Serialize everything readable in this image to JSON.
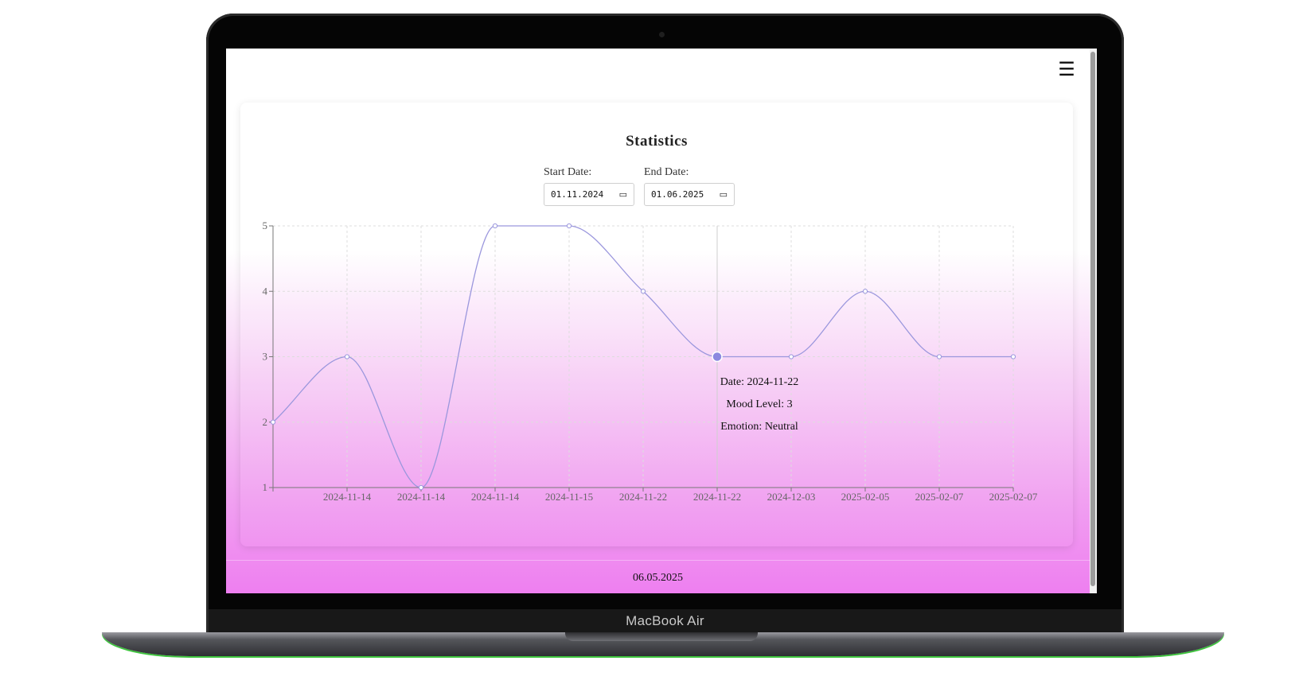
{
  "device": {
    "brand": "MacBook Air"
  },
  "header": {
    "menu_icon": "☰"
  },
  "page": {
    "title": "Statistics"
  },
  "filters": {
    "start_label": "Start Date:",
    "start_value": "01.11.2024",
    "end_label": "End Date:",
    "end_value": "01.06.2025",
    "calendar_icon": "calendar-icon"
  },
  "tooltip": {
    "date": "Date: 2024-11-22",
    "mood": "Mood Level: 3",
    "emotion": "Emotion: Neutral"
  },
  "footer": {
    "date": "06.05.2025"
  },
  "colors": {
    "line": "#9b97dd",
    "active_point": "#8c89e0",
    "gradient_end": "#ee7ff0"
  },
  "chart_data": {
    "type": "line",
    "x": [
      "",
      "2024-11-14",
      "2024-11-14",
      "2024-11-14",
      "2024-11-15",
      "2024-11-22",
      "2024-11-22",
      "2024-12-03",
      "2025-02-05",
      "2025-02-07",
      "2025-02-07"
    ],
    "series": [
      {
        "values": [
          2,
          3,
          1,
          5,
          5,
          4,
          3,
          3,
          4,
          3,
          3
        ]
      }
    ],
    "active_index": 6,
    "ylim": [
      1,
      5
    ],
    "yticks": [
      1,
      2,
      3,
      4,
      5
    ],
    "grid": true,
    "xlabel": "",
    "ylabel": "",
    "title": ""
  }
}
